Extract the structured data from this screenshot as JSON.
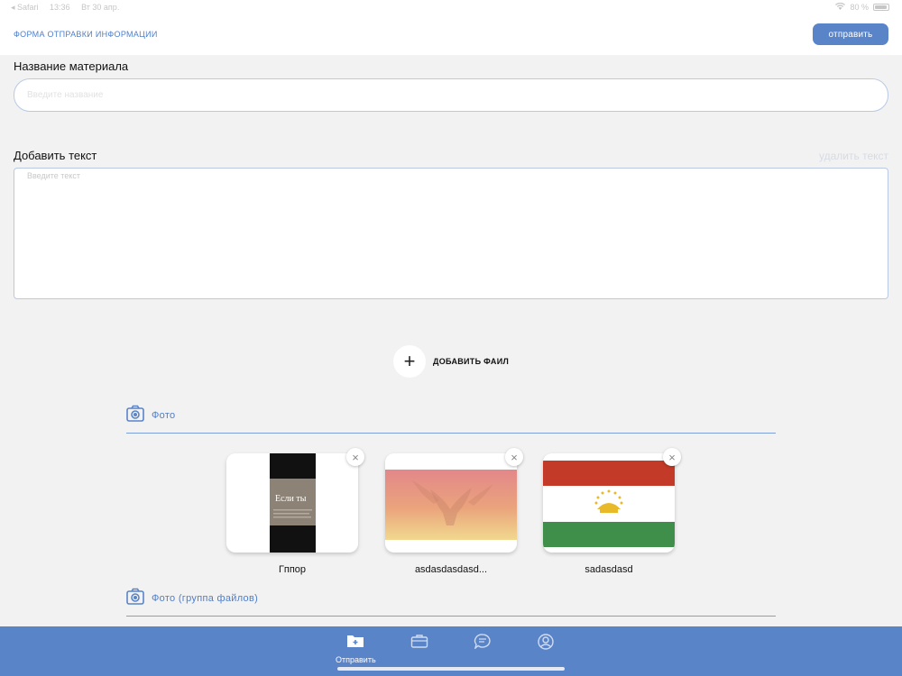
{
  "status_bar": {
    "back_app": "◂ Safari",
    "time": "13:36",
    "date": "Вт 30 апр.",
    "battery": "80 %"
  },
  "header": {
    "title": "ФОРМА ОТПРАВКИ ИНФОРМАЦИИ",
    "send_label": "отправить"
  },
  "form": {
    "name_label": "Название материала",
    "name_placeholder": "Введите название",
    "text_label": "Добавить текст",
    "delete_text": "удалить текст",
    "text_placeholder": "Введите текст",
    "add_file_label": "ДОБАВИТЬ ФАИЛ"
  },
  "photo_section": {
    "label": "Фото",
    "items": [
      {
        "name": "Гппор",
        "preview_text": "Если ты"
      },
      {
        "name": "asdasdasdasd..."
      },
      {
        "name": "sadasdasd"
      }
    ]
  },
  "photo_group_section": {
    "label": "Фото (группа файлов)"
  },
  "tabbar": {
    "active_label": "Отправить"
  },
  "colors": {
    "accent": "#5a84c8",
    "link": "#4f7fcb",
    "input_border": "#b9c9e4"
  }
}
